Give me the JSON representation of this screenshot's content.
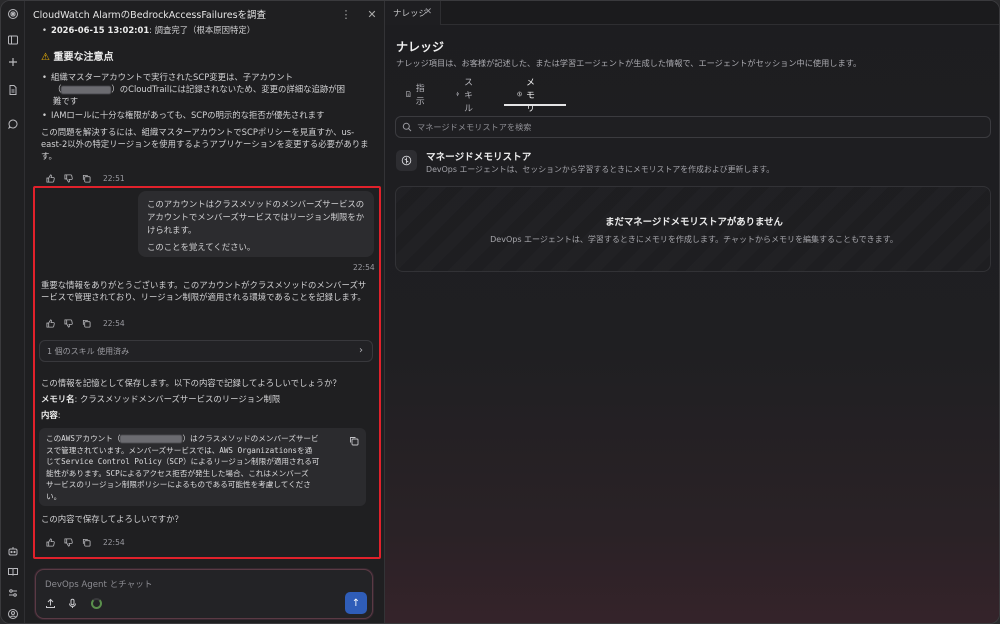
{
  "chat": {
    "title": "CloudWatch AlarmのBedrockAccessFailuresを調査",
    "prev": {
      "timeline_label": "2026-06-15 13:02:01",
      "timeline_text": ": 調査完了（根本原因特定）",
      "warning_heading": "重要な注意点",
      "bullet1_line1": "組織マスターアカウントで実行されたSCP変更は、子アカウント",
      "bullet1_line2_suffix": "）のCloudTrailには記録されないため、変更の詳細な追跡が困",
      "bullet1_line3": "難です",
      "bullet2": "IAMロールに十分な権限があっても、SCPの明示的な拒否が優先されます",
      "para_line1": "この問題を解決するには、組織マスターアカウントでSCPポリシーを見直すか、us-",
      "para_line2": "east-2以外の特定リージョンを使用するようアプリケーションを変更する必要がありま",
      "para_line3": "す。",
      "time": "22:51"
    },
    "user_message": {
      "line1": "このアカウントはクラスメソッドのメンバーズサービスの",
      "line2": "アカウントでメンバーズサービスではリージョン制限をか",
      "line3": "けられます。",
      "line4": "このことを覚えてください。",
      "time": "22:54"
    },
    "reply1": {
      "line1": "重要な情報をありがとうございます。このアカウントがクラスメソッドのメンバーズサ",
      "line2": "ービスで管理されており、リージョン制限が適用される環境であることを記録します。",
      "time": "22:54"
    },
    "skills_used": "1 個のスキル 使用済み",
    "reply2": {
      "question": "この情報を記憶として保存します。以下の内容で記録してよろしいでしょうか？",
      "memory_name_label": "メモリ名",
      "memory_name_value": ": クラスメソッドメンバーズサービスのリージョン制限",
      "content_label": "内容",
      "content_colon": ":",
      "code_line1_prefix": "このAWSアカウント（",
      "code_line1_suffix": "）はクラスメソッドのメンバーズサービ",
      "code_line2": "スで管理されています。メンバーズサービスでは、AWS Organizationsを通",
      "code_line3": "じてService Control Policy（SCP）によるリージョン制限が適用される可",
      "code_line4": "能性があります。SCPによるアクセス拒否が発生した場合、これはメンバーズ",
      "code_line5": "サービスのリージョン制限ポリシーによるものである可能性を考慮してくださ",
      "code_line6": "い。",
      "confirm": "この内容で保存してよろしいですか？",
      "time": "22:54"
    },
    "input": {
      "placeholder": "DevOps Agent とチャット"
    }
  },
  "knowledge": {
    "tab_label": "ナレッジ",
    "title": "ナレッジ",
    "description": "ナレッジ項目は、お客様が記述した、または学習エージェントが生成した情報で、エージェントがセッション中に使用します。",
    "tabs": [
      {
        "label": "指示",
        "icon": "document-icon"
      },
      {
        "label": "スキル",
        "icon": "sparkle-icon"
      },
      {
        "label": "メモリ",
        "icon": "brain-icon"
      }
    ],
    "active_tab": "メモリ",
    "search_placeholder": "マネージドメモリストアを検索",
    "store": {
      "title": "マネージドメモリストア",
      "description": "DevOps エージェントは、セッションから学習するときにメモリストアを作成および更新します。"
    },
    "empty": {
      "title": "まだマネージドメモリストアがありません",
      "description": "DevOps エージェントは、学習するときにメモリを作成します。チャットからメモリを編集することもできます。"
    }
  },
  "colors": {
    "highlight_border": "#e0212b",
    "send_button": "#2f5db8",
    "warning": "#f2b705"
  }
}
